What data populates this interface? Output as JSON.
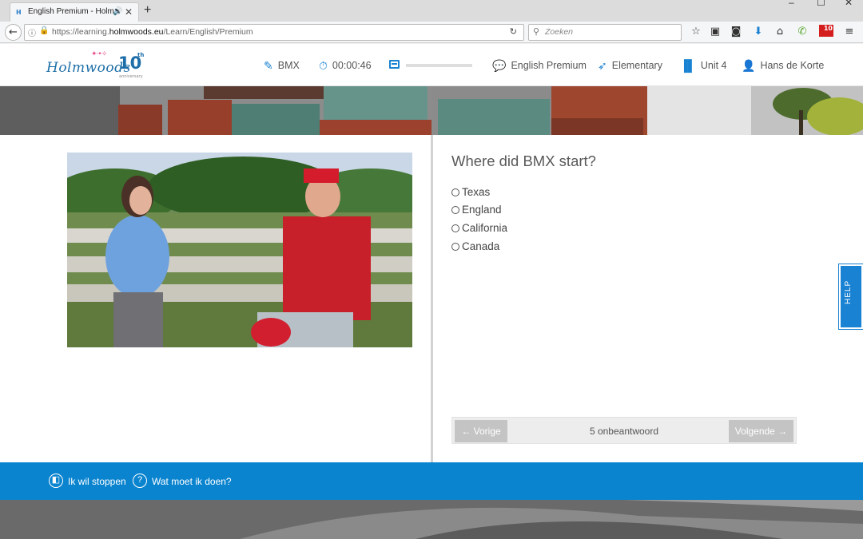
{
  "browser": {
    "tab_title": "English Premium - Holm",
    "url_prefix": "https://learning.",
    "url_domain": "holmwoods.eu",
    "url_path": "/Learn/English/Premium",
    "search_placeholder": "Zoeken",
    "addon_badge": "10"
  },
  "logo": {
    "name": "Holmwoods",
    "number": "10",
    "suffix": "th",
    "tagline": "anniversary"
  },
  "header": {
    "lesson": "BMX",
    "timer": "00:00:46",
    "progress_fraction": 0.0,
    "course": "English Premium",
    "level": "Elementary",
    "unit": "Unit 4",
    "user": "Hans de Korte"
  },
  "question": {
    "text": "Where did BMX start?",
    "options": [
      "Texas",
      "England",
      "California",
      "Canada"
    ]
  },
  "pager": {
    "prev": "← Vorige",
    "status": "5 onbeantwoord",
    "next": "Volgende →"
  },
  "help": {
    "label": "HELP"
  },
  "footer": {
    "stop": "Ik wil stoppen",
    "what_to_do": "Wat moet ik doen?"
  },
  "colors": {
    "accent": "#0a84cf",
    "icon_blue": "#1a82d2",
    "button_disabled": "#c4c4c4"
  }
}
